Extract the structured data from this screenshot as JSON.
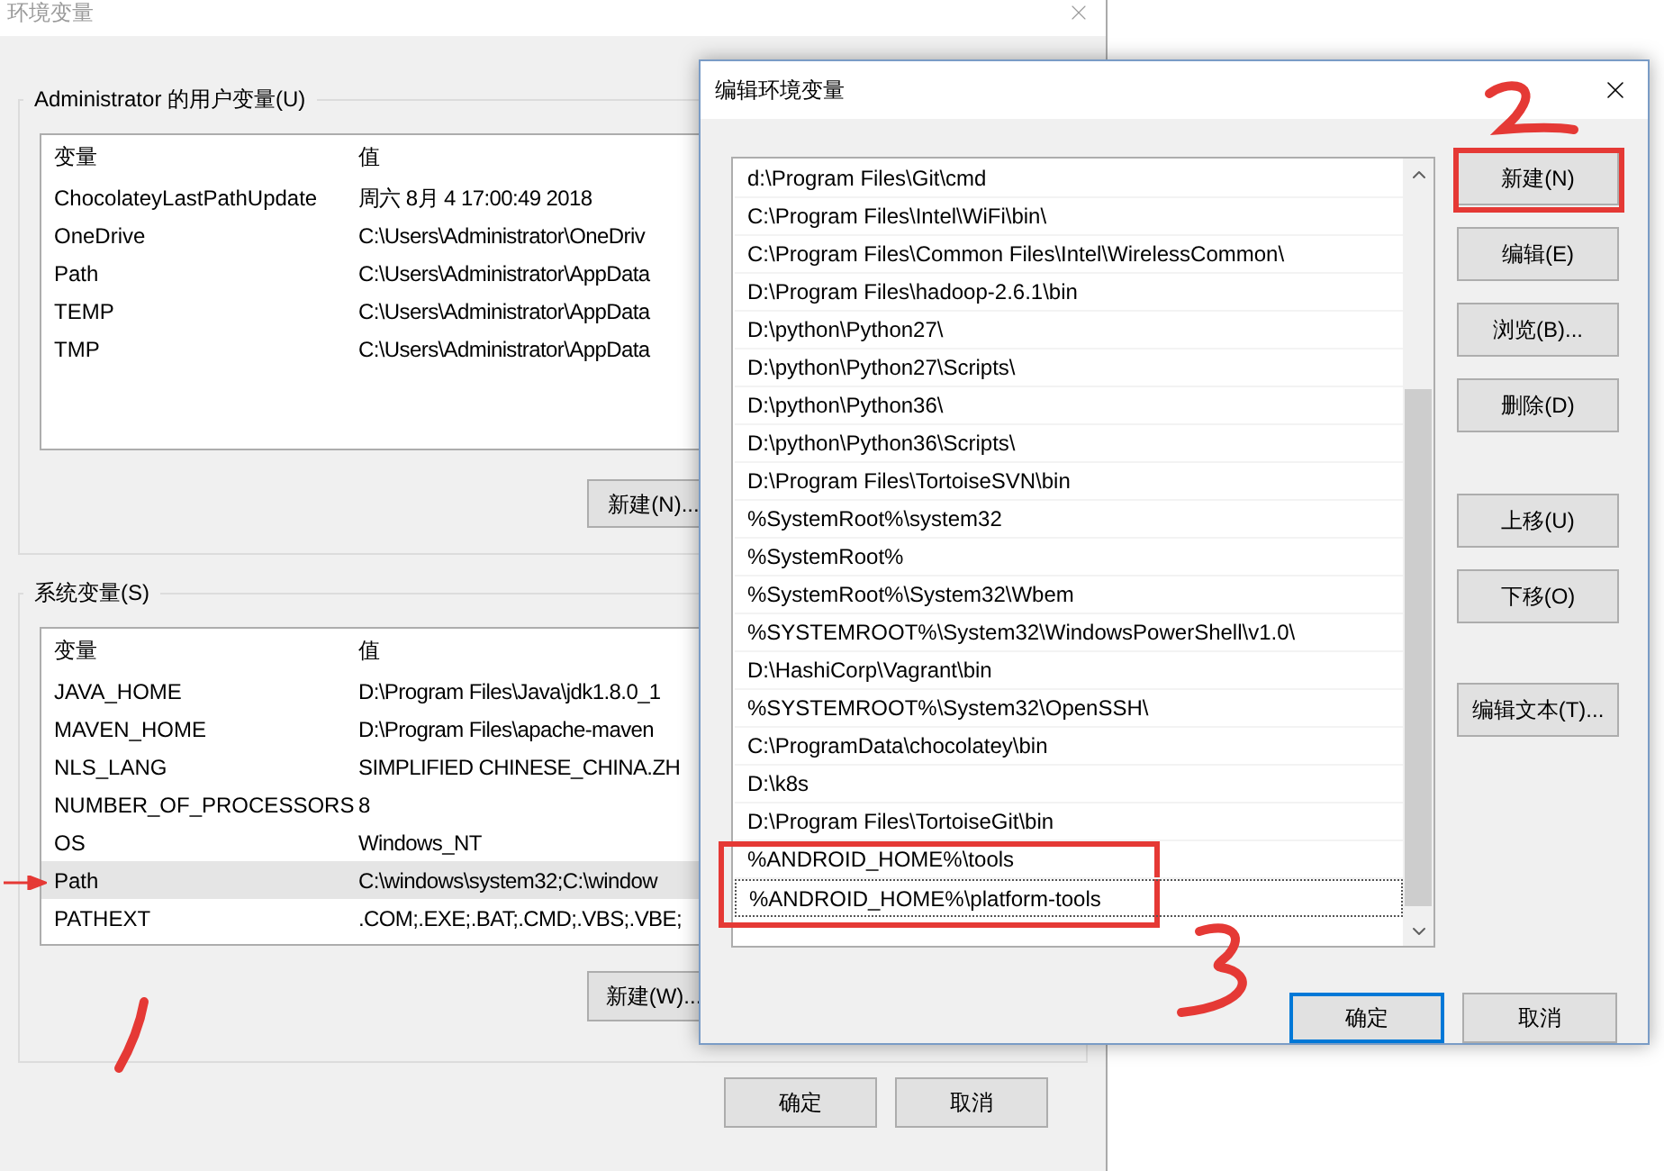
{
  "main_window": {
    "title": "环境变量",
    "user_vars": {
      "label": "Administrator 的用户变量(U)",
      "columns": [
        "变量",
        "值"
      ],
      "rows": [
        {
          "name": "ChocolateyLastPathUpdate",
          "value": "周六 8月  4 17:00:49 2018",
          "selected": false,
          "marked": false
        },
        {
          "name": "OneDrive",
          "value": "C:\\Users\\Administrator\\OneDriv",
          "selected": false,
          "marked": false
        },
        {
          "name": "Path",
          "value": "C:\\Users\\Administrator\\AppData",
          "selected": false,
          "marked": false
        },
        {
          "name": "TEMP",
          "value": "C:\\Users\\Administrator\\AppData",
          "selected": false,
          "marked": false
        },
        {
          "name": "TMP",
          "value": "C:\\Users\\Administrator\\AppData",
          "selected": false,
          "marked": false
        }
      ],
      "button": "新建(N)..."
    },
    "system_vars": {
      "label": "系统变量(S)",
      "columns": [
        "变量",
        "值"
      ],
      "rows": [
        {
          "name": "JAVA_HOME",
          "value": "D:\\Program Files\\Java\\jdk1.8.0_1",
          "selected": false,
          "marked": false
        },
        {
          "name": "MAVEN_HOME",
          "value": "D:\\Program Files\\apache-maven",
          "selected": false,
          "marked": false
        },
        {
          "name": "NLS_LANG",
          "value": "SIMPLIFIED CHINESE_CHINA.ZH",
          "selected": false,
          "marked": false
        },
        {
          "name": "NUMBER_OF_PROCESSORS",
          "value": "8",
          "selected": false,
          "marked": false
        },
        {
          "name": "OS",
          "value": "Windows_NT",
          "selected": false,
          "marked": false
        },
        {
          "name": "Path",
          "value": "C:\\windows\\system32;C:\\window",
          "selected": true,
          "marked": true
        },
        {
          "name": "PATHEXT",
          "value": ".COM;.EXE;.BAT;.CMD;.VBS;.VBE;",
          "selected": false,
          "marked": false
        }
      ],
      "button": "新建(W)..."
    },
    "buttons": [
      "确定",
      "取消"
    ]
  },
  "edit_dialog": {
    "title": "编辑环境变量",
    "entries": [
      {
        "text": "d:\\Program Files\\Git\\cmd",
        "selected": false,
        "annotated": false
      },
      {
        "text": "C:\\Program Files\\Intel\\WiFi\\bin\\",
        "selected": false,
        "annotated": false
      },
      {
        "text": "C:\\Program Files\\Common Files\\Intel\\WirelessCommon\\",
        "selected": false,
        "annotated": false
      },
      {
        "text": "D:\\Program Files\\hadoop-2.6.1\\bin",
        "selected": false,
        "annotated": false
      },
      {
        "text": "D:\\python\\Python27\\",
        "selected": false,
        "annotated": false
      },
      {
        "text": "D:\\python\\Python27\\Scripts\\",
        "selected": false,
        "annotated": false
      },
      {
        "text": "D:\\python\\Python36\\",
        "selected": false,
        "annotated": false
      },
      {
        "text": "D:\\python\\Python36\\Scripts\\",
        "selected": false,
        "annotated": false
      },
      {
        "text": "D:\\Program Files\\TortoiseSVN\\bin",
        "selected": false,
        "annotated": false
      },
      {
        "text": "%SystemRoot%\\system32",
        "selected": false,
        "annotated": false
      },
      {
        "text": "%SystemRoot%",
        "selected": false,
        "annotated": false
      },
      {
        "text": "%SystemRoot%\\System32\\Wbem",
        "selected": false,
        "annotated": false
      },
      {
        "text": "%SYSTEMROOT%\\System32\\WindowsPowerShell\\v1.0\\",
        "selected": false,
        "annotated": false
      },
      {
        "text": "D:\\HashiCorp\\Vagrant\\bin",
        "selected": false,
        "annotated": false
      },
      {
        "text": "%SYSTEMROOT%\\System32\\OpenSSH\\",
        "selected": false,
        "annotated": false
      },
      {
        "text": "C:\\ProgramData\\chocolatey\\bin",
        "selected": false,
        "annotated": false
      },
      {
        "text": "D:\\k8s",
        "selected": false,
        "annotated": false
      },
      {
        "text": "D:\\Program Files\\TortoiseGit\\bin",
        "selected": false,
        "annotated": false
      },
      {
        "text": "%ANDROID_HOME%\\tools",
        "selected": false,
        "annotated": true
      },
      {
        "text": "%ANDROID_HOME%\\platform-tools",
        "selected": true,
        "annotated": true
      }
    ],
    "side_buttons": [
      {
        "label": "新建(N)",
        "annotated": true
      },
      {
        "label": "编辑(E)",
        "annotated": false
      },
      {
        "label": "浏览(B)...",
        "annotated": false
      },
      {
        "label": "删除(D)",
        "annotated": false
      },
      {
        "label": "上移(U)",
        "annotated": false
      },
      {
        "label": "下移(O)",
        "annotated": false
      },
      {
        "label": "编辑文本(T)...",
        "annotated": false
      }
    ],
    "buttons": [
      {
        "label": "确定",
        "default": true
      },
      {
        "label": "取消",
        "default": false
      }
    ]
  }
}
